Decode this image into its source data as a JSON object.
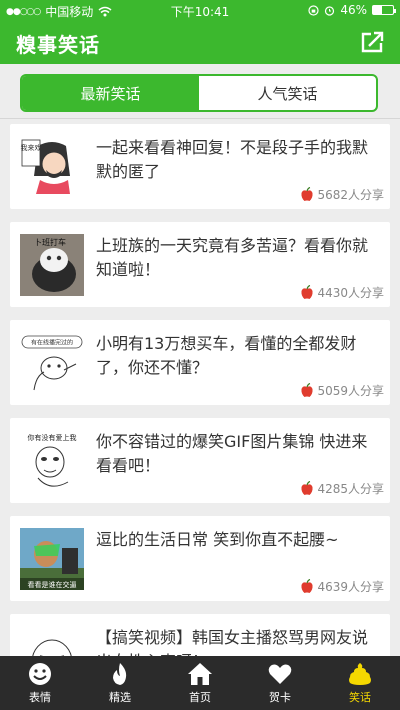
{
  "status": {
    "signal": "●●○○○",
    "carrier": "中国移动",
    "time": "下午10:41",
    "battery": "46%",
    "battery_level": 0.46
  },
  "header": {
    "title": "糗事笑话",
    "share_icon": "share-icon"
  },
  "tabs": [
    {
      "label": "最新笑话",
      "active": true
    },
    {
      "label": "人气笑话",
      "active": false
    }
  ],
  "items": [
    {
      "title": "一起来看看神回复！不是段子手的我默默的匿了",
      "shares": "5682人分享",
      "thumb_text": "我来戏"
    },
    {
      "title": "上班族的一天究竟有多苦逼？看看你就知道啦！",
      "shares": "4430人分享",
      "thumb_text": "卜班打车"
    },
    {
      "title": "小明有13万想买车，看懂的全都发财了，你还不懂？",
      "shares": "5059人分享",
      "thumb_text": "有在线播完过的"
    },
    {
      "title": "你不容错过的爆笑GIF图片集锦 快进来看看吧！",
      "shares": "4285人分享",
      "thumb_text": "你有没有爱上我"
    },
    {
      "title": "逗比的生活日常 笑到你直不起腰~",
      "shares": "4639人分享",
      "thumb_text": "看看是谁在交逼"
    },
    {
      "title": "【搞笑视频】韩国女主播怒骂男网友说出女性心声呀！",
      "shares": "",
      "thumb_text": ""
    }
  ],
  "tabbar": [
    {
      "label": "表情",
      "icon": "smiley-icon",
      "active": false
    },
    {
      "label": "精选",
      "icon": "flame-icon",
      "active": false
    },
    {
      "label": "首页",
      "icon": "home-icon",
      "active": false
    },
    {
      "label": "贺卡",
      "icon": "heart-icon",
      "active": false
    },
    {
      "label": "笑话",
      "icon": "poop-icon",
      "active": true
    }
  ],
  "colors": {
    "brand_green": "#3cb82e",
    "tab_bg": "#2b2b2b",
    "active_tab": "#f5d800",
    "apple_red": "#e03c2e"
  }
}
